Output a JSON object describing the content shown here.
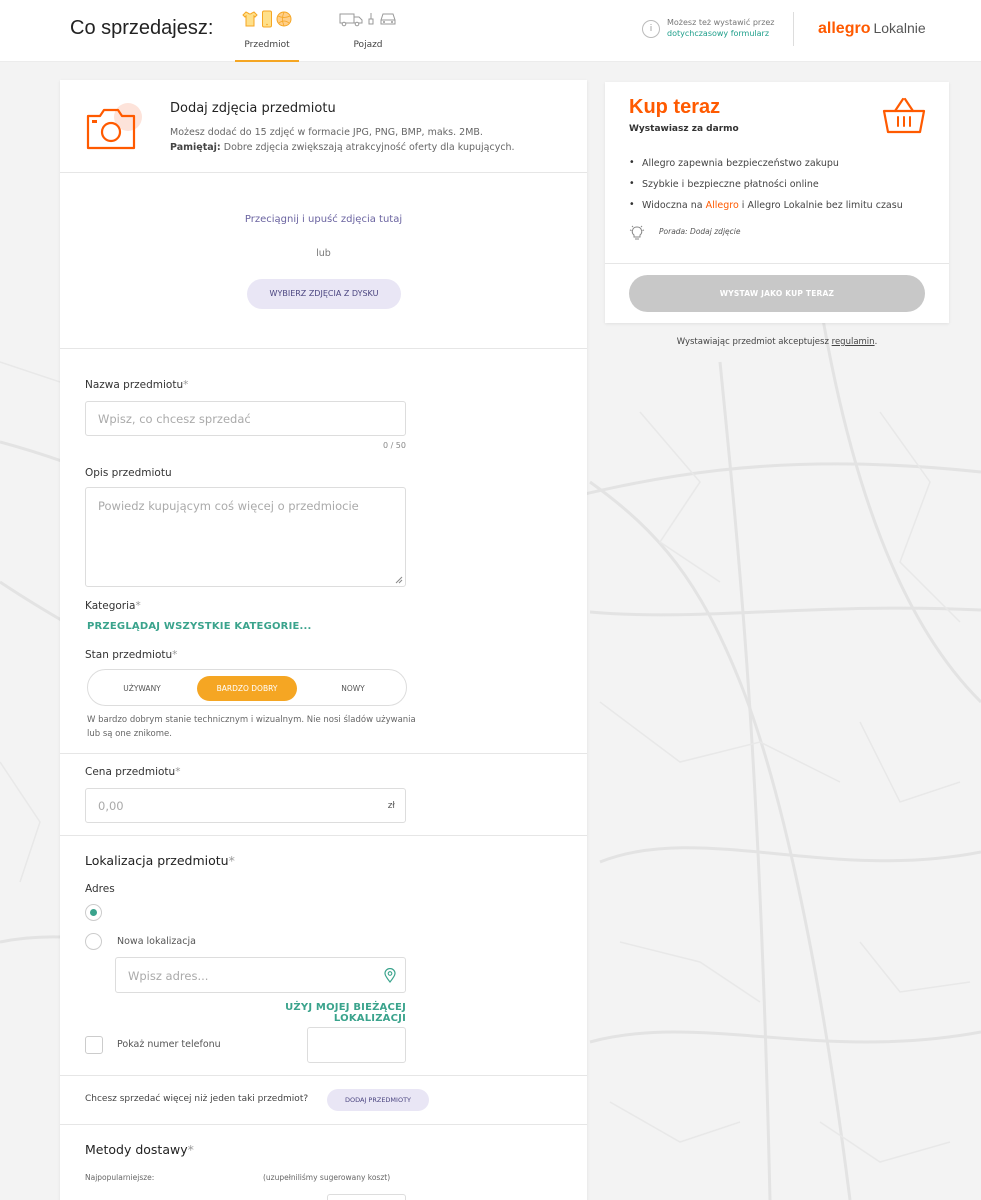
{
  "header": {
    "what_label": "Co sprzedajesz:",
    "tabs": [
      {
        "label": "Przedmiot",
        "active": true
      },
      {
        "label": "Pojazd",
        "active": false
      }
    ],
    "legacy_line1": "Możesz też wystawić przez",
    "legacy_link": "dotychczasowy formularz",
    "brand_main": "allegro",
    "brand_sub": "Lokalnie"
  },
  "photos": {
    "title": "Dodaj zdjęcia przedmiotu",
    "desc_line1": "Możesz dodać do 15 zdjęć w formacie JPG, PNG, BMP, maks. 2MB.",
    "desc_bold": "Pamiętaj:",
    "desc_line2": " Dobre zdjęcia zwiększają atrakcyjność oferty dla kupujących.",
    "drop_text": "Przeciągnij i upuść zdjęcia tutaj",
    "or_text": "lub",
    "pick_button": "WYBIERZ ZDJĘCIA Z DYSKU"
  },
  "item": {
    "name_label": "Nazwa przedmiotu",
    "name_placeholder": "Wpisz, co chcesz sprzedać",
    "name_counter": "0 / 50",
    "desc_label": "Opis przedmiotu",
    "desc_placeholder": "Powiedz kupującym coś więcej o przedmiocie",
    "category_label": "Kategoria",
    "category_link": "PRZEGLĄDAJ WSZYSTKIE KATEGORIE...",
    "condition_label": "Stan przedmiotu",
    "conditions": [
      {
        "label": "UŻYWANY",
        "selected": false
      },
      {
        "label": "BARDZO DOBRY",
        "selected": true
      },
      {
        "label": "NOWY",
        "selected": false
      }
    ],
    "condition_note": "W bardzo dobrym stanie technicznym i wizualnym. Nie nosi śladów używania lub są one znikome.",
    "required_mark": "*"
  },
  "price": {
    "label": "Cena przedmiotu",
    "placeholder": "0,00",
    "unit": "zł"
  },
  "location": {
    "title": "Lokalizacja przedmiotu",
    "address_label": "Adres",
    "new_location_label": "Nowa lokalizacja",
    "address_placeholder": "Wpisz adres...",
    "use_current_link": "UŻYJ MOJEJ BIEŻĄCEJ LOKALIZACJI",
    "show_phone_label": "Pokaż numer telefonu"
  },
  "multi": {
    "question": "Chcesz sprzedać więcej niż jeden taki przedmiot?",
    "button": "DODAJ PRZEDMIOTY"
  },
  "shipping": {
    "title": "Metody dostawy",
    "popular": "Najpopularniejsze:",
    "note": "(uzupełniliśmy sugerowany koszt)"
  },
  "side": {
    "title": "Kup teraz",
    "subtitle": "Wystawiasz za darmo",
    "benefit1": "Allegro zapewnia bezpieczeństwo zakupu",
    "benefit2": "Szybkie i bezpieczne płatności online",
    "benefit3_pre": "Widoczna na ",
    "benefit3_hl": "Allegro",
    "benefit3_post": " i Allegro Lokalnie bez limitu czasu",
    "tip": "Porada: Dodaj zdjęcie",
    "submit": "WYSTAW JAKO KUP TERAZ",
    "terms_pre": "Wystawiając przedmiot akceptujesz ",
    "terms_link": "regulamin",
    "terms_post": "."
  },
  "colors": {
    "accent_orange": "#ff5a00",
    "tab_yellow": "#f5a623",
    "teal": "#3aa38c",
    "lavender_button": "#e9e6f5"
  }
}
